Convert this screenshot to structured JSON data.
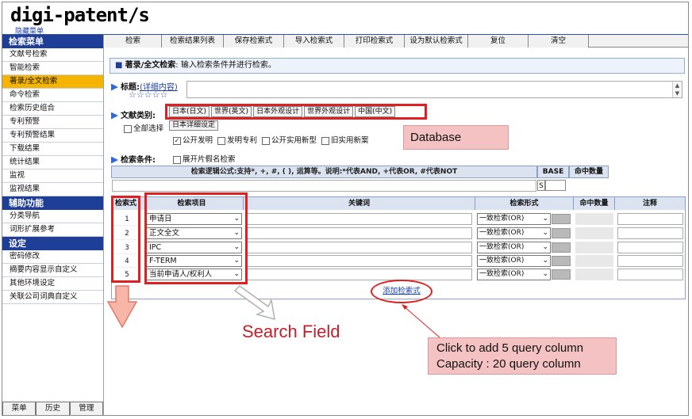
{
  "header": {
    "logo": "digi-patent/s",
    "hide_menu": "隐藏菜单"
  },
  "sidebar": {
    "section1": "检索菜单",
    "items1": [
      "文献号检索",
      "智能检索",
      "著录/全文检索",
      "命令检索",
      "检索历史组合",
      "专利预警",
      "专利预警结果",
      "下载结果",
      "统计结果",
      "监视",
      "监视结果"
    ],
    "active_index": 2,
    "section2": "辅助功能",
    "items2": [
      "分类导航",
      "词形扩展参考"
    ],
    "section3": "设定",
    "items3": [
      "密码修改",
      "摘要内容显示自定义",
      "其他环境设定",
      "关联公司词典自定义"
    ],
    "tabs": [
      "菜单",
      "历史",
      "管理"
    ]
  },
  "toolbar": [
    "检索",
    "检索结果列表",
    "保存检索式",
    "导入检索式",
    "打印检索式",
    "设为默认检索式",
    "复位",
    "清空"
  ],
  "content": {
    "title_prefix": "■",
    "title_bold": "著录/全文检索",
    "title_rest": ": 输入检索条件并进行检索。",
    "title_label": "标题:",
    "title_detail": "(详细内容)",
    "stars": "☆☆☆☆☆",
    "doctype_label": "文献类别:",
    "databases": [
      "日本(日文)",
      "世界(英文)",
      "日本外观设计",
      "世界外观设计",
      "中国(中文)"
    ],
    "jp_detail": "日本详细设定",
    "select_all": "全部选择",
    "patent_types": [
      {
        "label": "公开发明",
        "checked": true
      },
      {
        "label": "发明专利",
        "checked": false
      },
      {
        "label": "公开实用新型",
        "checked": false
      },
      {
        "label": "旧实用新案",
        "checked": false
      }
    ],
    "cond_label": "检索条件:",
    "expand_kana": "展开片假名检索",
    "logic_header": "检索逻辑公式:支持*, +, #, ( ), 运算等。说明:*代表AND, +代表OR, #代表NOT",
    "base_header": "BASE",
    "hit_header": "命中数量",
    "base_s": "S"
  },
  "grid": {
    "headers": [
      "检索式",
      "检索项目",
      "关键词",
      "检索形式",
      "命中数量",
      "注释"
    ],
    "rows": [
      {
        "num": "1",
        "field": "申请日",
        "form": "一致检索(OR)"
      },
      {
        "num": "2",
        "field": "正文全文",
        "form": "一致检索(OR)"
      },
      {
        "num": "3",
        "field": "IPC",
        "form": "一致检索(OR)"
      },
      {
        "num": "4",
        "field": "F-TERM",
        "form": "一致检索(OR)"
      },
      {
        "num": "5",
        "field": "当前申请人/权利人",
        "form": "一致检索(OR)"
      }
    ],
    "add_query": "添加检索式"
  },
  "annotations": {
    "database": "Database",
    "search_field": "Search Field",
    "callout_line1": "Click to add 5 query column",
    "callout_line2": "Capacity : 20 query column"
  },
  "colors": {
    "nav_blue": "#1f3e98",
    "active_orange": "#f4b400",
    "annotation_red": "#e02020",
    "callout_pink": "#f4c2c2"
  }
}
